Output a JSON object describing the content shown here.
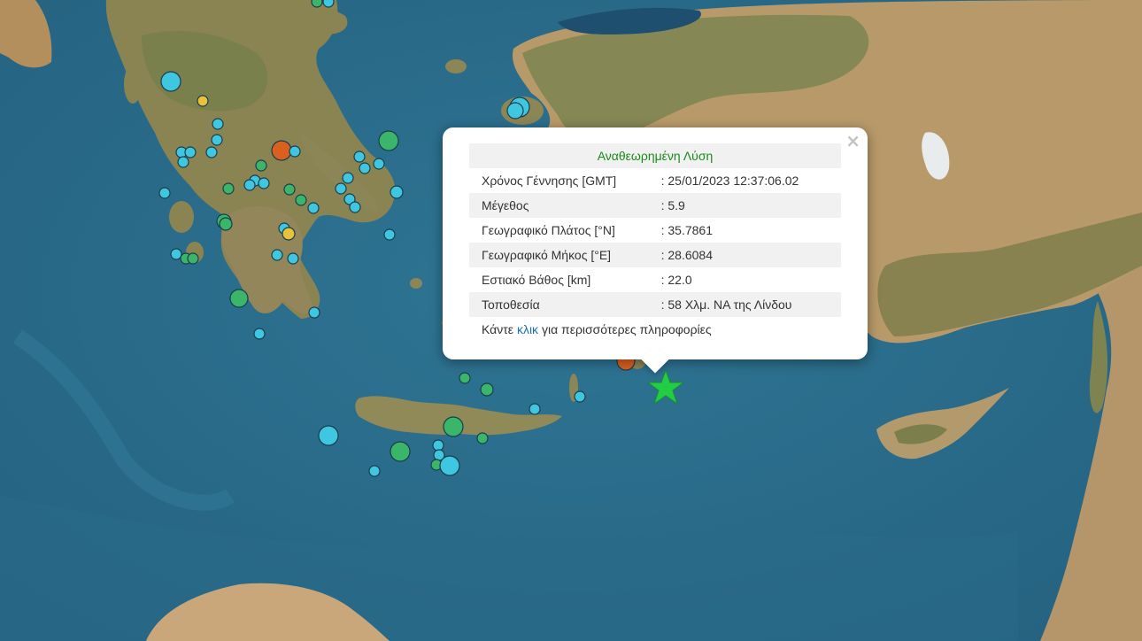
{
  "popup": {
    "title": "Αναθεωρημένη Λύση",
    "close_label": "×",
    "rows": [
      {
        "label": "Χρόνος Γέννησης [GMT]",
        "value": ": 25/01/2023 12:37:06.02"
      },
      {
        "label": "Μέγεθος",
        "value": ": 5.9"
      },
      {
        "label": "Γεωγραφικό Πλάτος [°N]",
        "value": ": 35.7861"
      },
      {
        "label": "Γεωγραφικό Μήκος [°E]",
        "value": ": 28.6084"
      },
      {
        "label": "Εστιακό Βάθος [km]",
        "value": ": 22.0"
      },
      {
        "label": "Τοποθεσία",
        "value": ": 58 Χλμ. ΝΑ της Λίνδου"
      }
    ],
    "more_prefix": "Κάντε",
    "more_link": "κλικ",
    "more_suffix": "για περισσότερες πληροφορίες"
  },
  "colors": {
    "sea": "#2d6f8f",
    "land": "#b89a6a",
    "forest": "#6f7f45",
    "marker_cyan": "#3fc6e0",
    "marker_green": "#3bb56a",
    "marker_yellow": "#e8c23a",
    "marker_orange": "#d9601e",
    "epicenter_star": "#22cc44"
  },
  "icons": {
    "epicenter": "star-icon",
    "close": "close-icon"
  }
}
